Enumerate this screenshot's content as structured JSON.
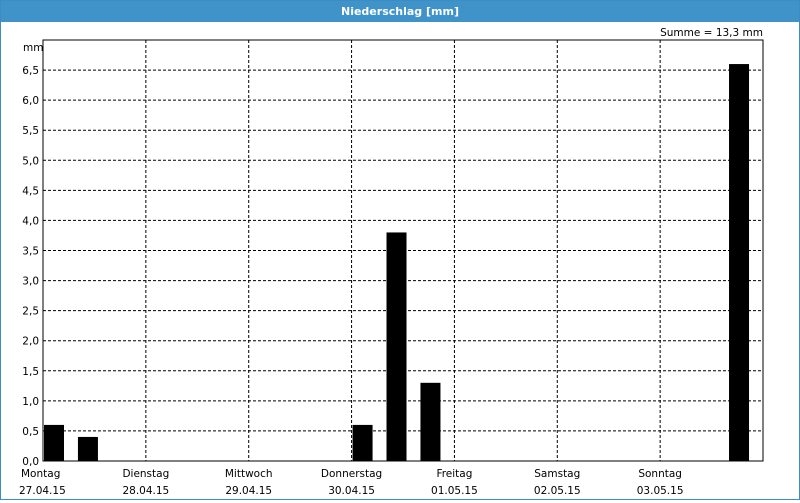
{
  "window": {
    "title": "Niederschlag [mm]"
  },
  "chart_data": {
    "type": "bar",
    "title": "Niederschlag [mm]",
    "ylabel": "mm",
    "ylim": [
      0,
      7.0
    ],
    "yticks": [
      "0,0",
      "0,5",
      "1,0",
      "1,5",
      "2,0",
      "2,5",
      "3,0",
      "3,5",
      "4,0",
      "4,5",
      "5,0",
      "5,5",
      "6,0",
      "6,5"
    ],
    "summary": "Summe = 13,3 mm",
    "grid": true,
    "x_days": [
      {
        "day": "Montag",
        "date": "27.04.15"
      },
      {
        "day": "Dienstag",
        "date": "28.04.15"
      },
      {
        "day": "Mittwoch",
        "date": "29.04.15"
      },
      {
        "day": "Donnerstag",
        "date": "30.04.15"
      },
      {
        "day": "Freitag",
        "date": "01.05.15"
      },
      {
        "day": "Samstag",
        "date": "02.05.15"
      },
      {
        "day": "Sonntag",
        "date": "03.05.15"
      }
    ],
    "bars": [
      {
        "day_offset": 0.0,
        "value": 0.6
      },
      {
        "day_offset": 0.33,
        "value": 0.4
      },
      {
        "day_offset": 3.0,
        "value": 0.6
      },
      {
        "day_offset": 3.33,
        "value": 3.8
      },
      {
        "day_offset": 3.66,
        "value": 1.3
      },
      {
        "day_offset": 6.66,
        "value": 6.6
      }
    ]
  }
}
